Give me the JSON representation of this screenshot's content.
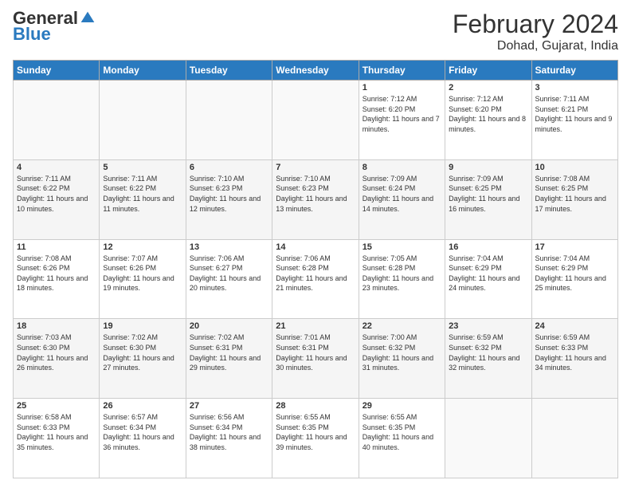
{
  "header": {
    "logo_general": "General",
    "logo_blue": "Blue",
    "month_title": "February 2024",
    "location": "Dohad, Gujarat, India"
  },
  "days_of_week": [
    "Sunday",
    "Monday",
    "Tuesday",
    "Wednesday",
    "Thursday",
    "Friday",
    "Saturday"
  ],
  "weeks": [
    [
      {
        "day": "",
        "info": ""
      },
      {
        "day": "",
        "info": ""
      },
      {
        "day": "",
        "info": ""
      },
      {
        "day": "",
        "info": ""
      },
      {
        "day": "1",
        "info": "Sunrise: 7:12 AM\nSunset: 6:20 PM\nDaylight: 11 hours and 7 minutes."
      },
      {
        "day": "2",
        "info": "Sunrise: 7:12 AM\nSunset: 6:20 PM\nDaylight: 11 hours and 8 minutes."
      },
      {
        "day": "3",
        "info": "Sunrise: 7:11 AM\nSunset: 6:21 PM\nDaylight: 11 hours and 9 minutes."
      }
    ],
    [
      {
        "day": "4",
        "info": "Sunrise: 7:11 AM\nSunset: 6:22 PM\nDaylight: 11 hours and 10 minutes."
      },
      {
        "day": "5",
        "info": "Sunrise: 7:11 AM\nSunset: 6:22 PM\nDaylight: 11 hours and 11 minutes."
      },
      {
        "day": "6",
        "info": "Sunrise: 7:10 AM\nSunset: 6:23 PM\nDaylight: 11 hours and 12 minutes."
      },
      {
        "day": "7",
        "info": "Sunrise: 7:10 AM\nSunset: 6:23 PM\nDaylight: 11 hours and 13 minutes."
      },
      {
        "day": "8",
        "info": "Sunrise: 7:09 AM\nSunset: 6:24 PM\nDaylight: 11 hours and 14 minutes."
      },
      {
        "day": "9",
        "info": "Sunrise: 7:09 AM\nSunset: 6:25 PM\nDaylight: 11 hours and 16 minutes."
      },
      {
        "day": "10",
        "info": "Sunrise: 7:08 AM\nSunset: 6:25 PM\nDaylight: 11 hours and 17 minutes."
      }
    ],
    [
      {
        "day": "11",
        "info": "Sunrise: 7:08 AM\nSunset: 6:26 PM\nDaylight: 11 hours and 18 minutes."
      },
      {
        "day": "12",
        "info": "Sunrise: 7:07 AM\nSunset: 6:26 PM\nDaylight: 11 hours and 19 minutes."
      },
      {
        "day": "13",
        "info": "Sunrise: 7:06 AM\nSunset: 6:27 PM\nDaylight: 11 hours and 20 minutes."
      },
      {
        "day": "14",
        "info": "Sunrise: 7:06 AM\nSunset: 6:28 PM\nDaylight: 11 hours and 21 minutes."
      },
      {
        "day": "15",
        "info": "Sunrise: 7:05 AM\nSunset: 6:28 PM\nDaylight: 11 hours and 23 minutes."
      },
      {
        "day": "16",
        "info": "Sunrise: 7:04 AM\nSunset: 6:29 PM\nDaylight: 11 hours and 24 minutes."
      },
      {
        "day": "17",
        "info": "Sunrise: 7:04 AM\nSunset: 6:29 PM\nDaylight: 11 hours and 25 minutes."
      }
    ],
    [
      {
        "day": "18",
        "info": "Sunrise: 7:03 AM\nSunset: 6:30 PM\nDaylight: 11 hours and 26 minutes."
      },
      {
        "day": "19",
        "info": "Sunrise: 7:02 AM\nSunset: 6:30 PM\nDaylight: 11 hours and 27 minutes."
      },
      {
        "day": "20",
        "info": "Sunrise: 7:02 AM\nSunset: 6:31 PM\nDaylight: 11 hours and 29 minutes."
      },
      {
        "day": "21",
        "info": "Sunrise: 7:01 AM\nSunset: 6:31 PM\nDaylight: 11 hours and 30 minutes."
      },
      {
        "day": "22",
        "info": "Sunrise: 7:00 AM\nSunset: 6:32 PM\nDaylight: 11 hours and 31 minutes."
      },
      {
        "day": "23",
        "info": "Sunrise: 6:59 AM\nSunset: 6:32 PM\nDaylight: 11 hours and 32 minutes."
      },
      {
        "day": "24",
        "info": "Sunrise: 6:59 AM\nSunset: 6:33 PM\nDaylight: 11 hours and 34 minutes."
      }
    ],
    [
      {
        "day": "25",
        "info": "Sunrise: 6:58 AM\nSunset: 6:33 PM\nDaylight: 11 hours and 35 minutes."
      },
      {
        "day": "26",
        "info": "Sunrise: 6:57 AM\nSunset: 6:34 PM\nDaylight: 11 hours and 36 minutes."
      },
      {
        "day": "27",
        "info": "Sunrise: 6:56 AM\nSunset: 6:34 PM\nDaylight: 11 hours and 38 minutes."
      },
      {
        "day": "28",
        "info": "Sunrise: 6:55 AM\nSunset: 6:35 PM\nDaylight: 11 hours and 39 minutes."
      },
      {
        "day": "29",
        "info": "Sunrise: 6:55 AM\nSunset: 6:35 PM\nDaylight: 11 hours and 40 minutes."
      },
      {
        "day": "",
        "info": ""
      },
      {
        "day": "",
        "info": ""
      }
    ]
  ]
}
